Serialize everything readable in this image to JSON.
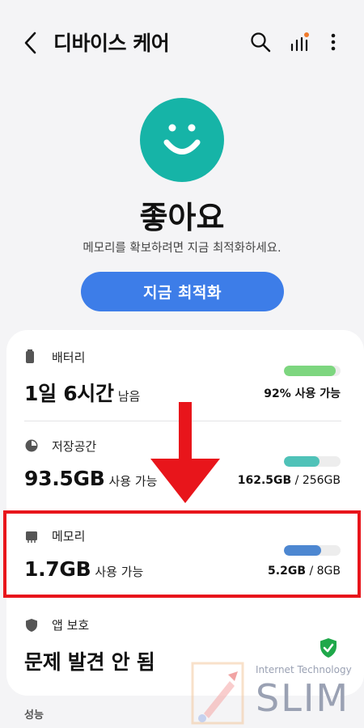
{
  "header": {
    "title": "디바이스 케어",
    "icons": [
      "back-icon",
      "search-icon",
      "signal-bars-icon",
      "more-options-icon"
    ]
  },
  "status": {
    "icon": "smiley-face-icon",
    "label": "좋아요",
    "message": "메모리를 확보하려면 지금 최적화하세요.",
    "button_label": "지금 최적화"
  },
  "items": {
    "battery": {
      "label": "배터리",
      "value": "1일 6시간",
      "value_suffix": "남음",
      "right_text": "92% 사용 가능",
      "level": 0.92,
      "color": "#7dd67f",
      "icon": "battery-icon"
    },
    "storage": {
      "label": "저장공간",
      "value": "93.5GB",
      "value_suffix": "사용 가능",
      "right_used": "162.5GB",
      "right_total": " / 256GB",
      "level": 0.635,
      "color": "#4fc2b8",
      "icon": "storage-pie-icon"
    },
    "memory": {
      "label": "메모리",
      "value": "1.7GB",
      "value_suffix": "사용 가능",
      "right_used": "5.2GB",
      "right_total": " / 8GB",
      "level": 0.65,
      "color": "#4d87d1",
      "icon": "memory-chip-icon"
    },
    "app_protection": {
      "label": "앱 보호",
      "value": "문제 발견 안 됨",
      "icon": "shield-icon",
      "status_icon": "shield-check-icon",
      "status_color": "#1fa84a"
    }
  },
  "performance": {
    "label": "성능"
  },
  "annotation": {
    "highlight_color": "#e8151b"
  },
  "watermark": {
    "line1": "Internet Technology",
    "line2": "SLIM"
  }
}
